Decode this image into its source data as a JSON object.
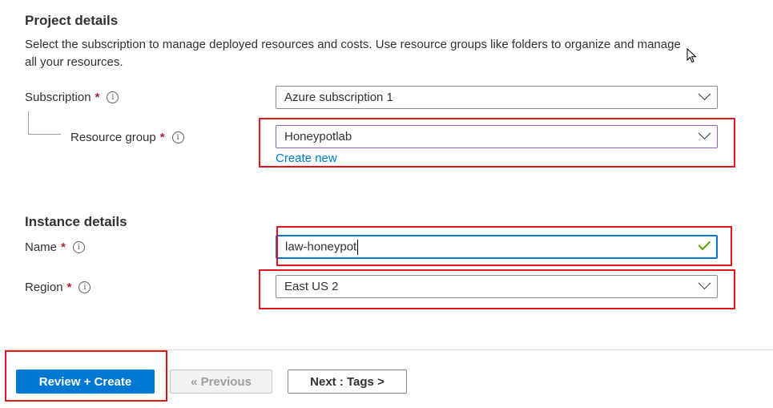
{
  "project": {
    "title": "Project details",
    "description": "Select the subscription to manage deployed resources and costs. Use resource groups like folders to organize and manage all your resources."
  },
  "subscription": {
    "label": "Subscription",
    "required_mark": "*",
    "info": "i",
    "value": "Azure subscription 1"
  },
  "resource_group": {
    "label": "Resource group",
    "required_mark": "*",
    "info": "i",
    "value": "Honeypotlab",
    "create_new": "Create new"
  },
  "instance": {
    "title": "Instance details"
  },
  "name": {
    "label": "Name",
    "required_mark": "*",
    "info": "i",
    "value": "law-honeypot"
  },
  "region": {
    "label": "Region",
    "required_mark": "*",
    "info": "i",
    "value": "East US 2"
  },
  "footer": {
    "review_create": "Review + Create",
    "previous": "« Previous",
    "next": "Next : Tags >"
  },
  "colors": {
    "primary": "#0078d4",
    "required": "#a4262c",
    "highlight": "#e3141b",
    "valid": "#57a300"
  }
}
